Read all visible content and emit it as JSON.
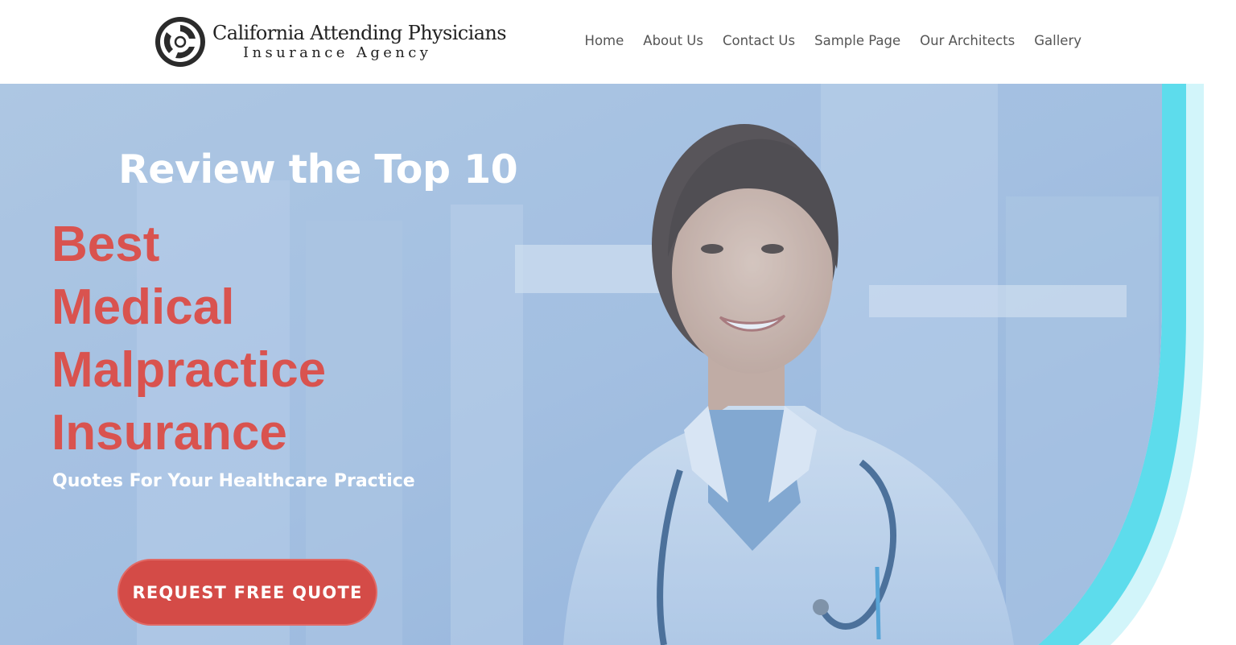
{
  "brand": {
    "name_line1": "California Attending Physicians",
    "name_line2": "Insurance Agency",
    "logo_icon": "circular-arrows-logo-icon"
  },
  "nav": {
    "items": [
      {
        "label": "Home"
      },
      {
        "label": "About Us"
      },
      {
        "label": "Contact Us"
      },
      {
        "label": "Sample Page"
      },
      {
        "label": "Our Architects"
      },
      {
        "label": "Gallery"
      }
    ]
  },
  "hero": {
    "eyebrow": "Review the Top 10",
    "title_lines": [
      "Best",
      "Medical",
      "Malpractice",
      "Insurance"
    ],
    "subtitle": "Quotes For Your Healthcare Practice",
    "cta_label": "REQUEST FREE QUOTE",
    "image": "smiling-female-doctor-with-stethoscope-photo"
  },
  "colors": {
    "accent_red": "#d9534f",
    "button_red": "#d44b47",
    "accent_cyan": "#5ddcec",
    "hero_overlay": "#9fbde0",
    "nav_text": "#555555"
  }
}
